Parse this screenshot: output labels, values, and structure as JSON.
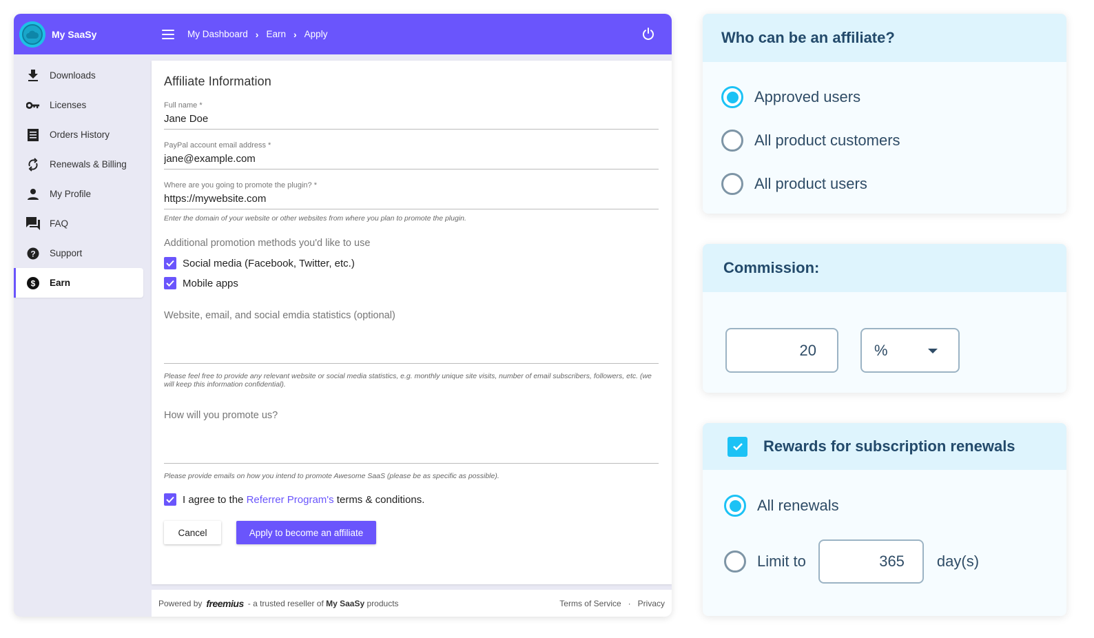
{
  "app": {
    "brand": "My SaaSy",
    "breadcrumb": [
      "My Dashboard",
      "Earn",
      "Apply"
    ],
    "accent_color": "#6a55fc"
  },
  "sidebar": {
    "items": [
      {
        "label": "Downloads",
        "icon": "download-icon"
      },
      {
        "label": "Licenses",
        "icon": "key-icon"
      },
      {
        "label": "Orders History",
        "icon": "receipt-icon"
      },
      {
        "label": "Renewals & Billing",
        "icon": "refresh-icon"
      },
      {
        "label": "My Profile",
        "icon": "person-icon"
      },
      {
        "label": "FAQ",
        "icon": "forum-icon"
      },
      {
        "label": "Support",
        "icon": "help-icon"
      },
      {
        "label": "Earn",
        "icon": "dollar-icon",
        "active": true
      }
    ]
  },
  "form": {
    "title": "Affiliate Information",
    "full_name": {
      "label": "Full name *",
      "value": "Jane Doe"
    },
    "paypal": {
      "label": "PayPal account email address *",
      "value": "jane@example.com"
    },
    "promote_where": {
      "label": "Where are you going to promote the plugin? *",
      "value": "https://mywebsite.com",
      "hint": "Enter the domain of your website or other websites from where you plan to promote the plugin."
    },
    "methods_label": "Additional promotion methods you'd like to use",
    "methods": [
      {
        "label": "Social media (Facebook, Twitter, etc.)",
        "checked": true
      },
      {
        "label": "Mobile apps",
        "checked": true
      }
    ],
    "stats": {
      "placeholder": "Website, email, and social emdia statistics (optional)",
      "hint": "Please feel free to provide any relevant website or social media statistics, e.g. monthly unique site visits, number of email subscribers, followers, etc. (we will keep this information confidential)."
    },
    "how_promote": {
      "placeholder": "How will you promote us?",
      "hint": "Please provide emails on how you intend to promote Awesome SaaS (please be as specific as possible)."
    },
    "agree": {
      "checked": true,
      "prefix": "I agree to the ",
      "link": "Referrer Program's",
      "suffix": " terms & conditions."
    },
    "cancel_label": "Cancel",
    "apply_label": "Apply to become an affiliate"
  },
  "footer": {
    "powered_by": "Powered by",
    "freemius": "freemius",
    "reseller_prefix": "- a trusted reseller of",
    "reseller_brand": "My SaaSy",
    "reseller_suffix": "products",
    "terms": "Terms of Service",
    "dot": "·",
    "privacy": "Privacy"
  },
  "affiliate_card": {
    "title": "Who can be an affiliate?",
    "options": [
      {
        "label": "Approved users",
        "selected": true
      },
      {
        "label": "All product customers",
        "selected": false
      },
      {
        "label": "All product users",
        "selected": false
      }
    ]
  },
  "commission_card": {
    "title": "Commission:",
    "amount": "20",
    "unit": "%"
  },
  "renewals_card": {
    "title": "Rewards for subscription renewals",
    "enabled": true,
    "all_label": "All renewals",
    "all_selected": true,
    "limit_label": "Limit to",
    "limit_value": "365",
    "limit_unit": "day(s)",
    "highlight_color": "#1cc2f5"
  }
}
